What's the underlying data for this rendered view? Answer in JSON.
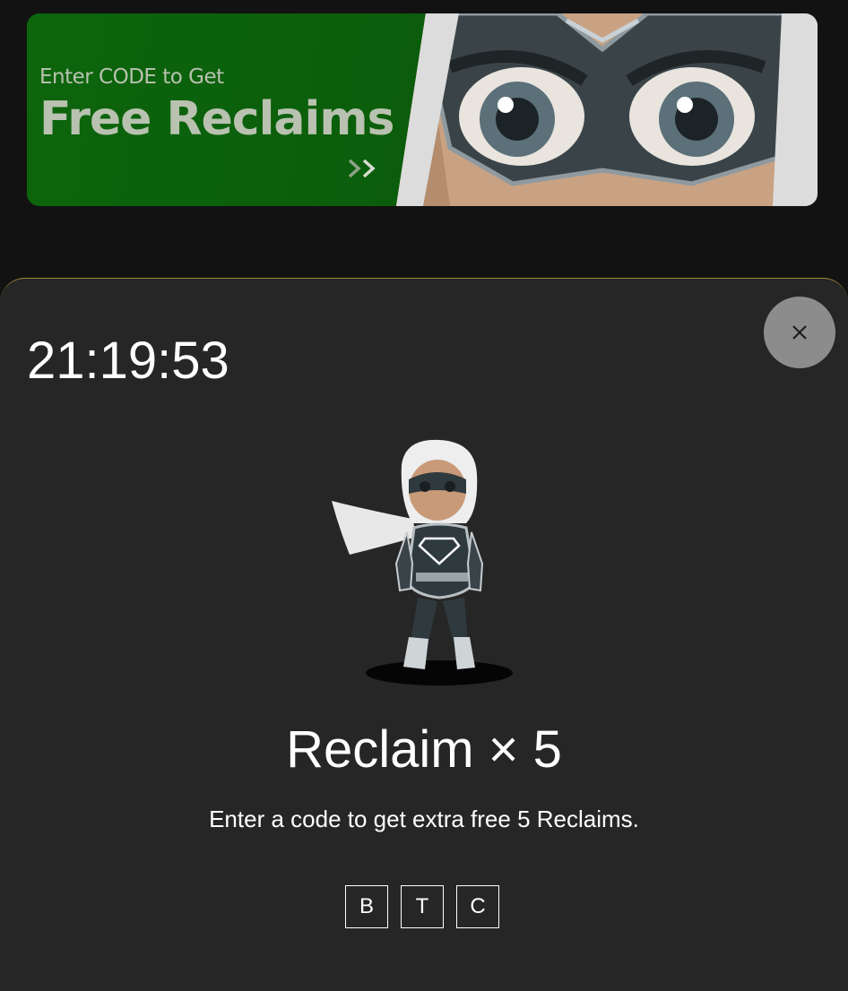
{
  "banner": {
    "small_text": "Enter CODE to Get",
    "big_text": "Free Reclaims",
    "arrow_icon": "double-chevron-right-icon",
    "colors": {
      "green": "#0c5f0c",
      "text": "#b9c2b0"
    }
  },
  "sheet": {
    "timer": "21:19:53",
    "close_icon": "close-icon",
    "hero_image": "masked-hero-illustration",
    "title": "Reclaim × 5",
    "subtitle": "Enter a code to get extra free 5 Reclaims.",
    "code_chars": [
      "B",
      "T",
      "C"
    ],
    "colors": {
      "background": "#262626",
      "accent_border": "#a08a3c",
      "close_bg": "#8c8c8c"
    }
  }
}
